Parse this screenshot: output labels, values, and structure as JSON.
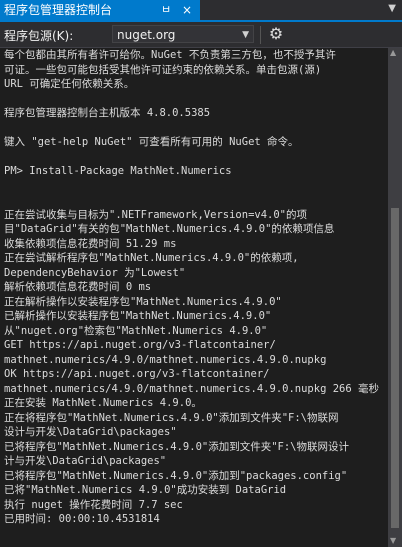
{
  "tab": {
    "title": "程序包管理器控制台",
    "pin": "ㅂ",
    "close": "×"
  },
  "toolbar": {
    "source_label": "程序包源(K):",
    "source_value": "nuget.org",
    "dropdown_arrow": "▼",
    "settings_icon": "⚙"
  },
  "window": {
    "dropdown_arrow": "▼"
  },
  "console": {
    "lines": [
      "每个包都由其所有者许可给你。NuGet 不负责第三方包，也不授予其许",
      "可证。一些包可能包括受其他许可证约束的依赖关系。单击包源(源)",
      "URL 可确定任何依赖关系。",
      "",
      "程序包管理器控制台主机版本 4.8.0.5385",
      "",
      "键入 \"get-help NuGet\" 可查看所有可用的 NuGet 命令。",
      "",
      "PM> Install-Package MathNet.Numerics",
      "",
      "",
      "正在尝试收集与目标为\".NETFramework,Version=v4.0\"的项",
      "目\"DataGrid\"有关的包\"MathNet.Numerics.4.9.0\"的依赖项信息",
      "收集依赖项信息花费时间 51.29 ms",
      "正在尝试解析程序包\"MathNet.Numerics.4.9.0\"的依赖项,",
      "DependencyBehavior 为\"Lowest\"",
      "解析依赖项信息花费时间 0 ms",
      "正在解析操作以安装程序包\"MathNet.Numerics.4.9.0\"",
      "已解析操作以安装程序包\"MathNet.Numerics.4.9.0\"",
      "从\"nuget.org\"检索包\"MathNet.Numerics 4.9.0\"",
      "  GET https://api.nuget.org/v3-flatcontainer/",
      "mathnet.numerics/4.9.0/mathnet.numerics.4.9.0.nupkg",
      "  OK https://api.nuget.org/v3-flatcontainer/",
      "mathnet.numerics/4.9.0/mathnet.numerics.4.9.0.nupkg 266 毫秒",
      "正在安装 MathNet.Numerics 4.9.0。",
      "正在将程序包\"MathNet.Numerics.4.9.0\"添加到文件夹\"F:\\物联网",
      "设计与开发\\DataGrid\\packages\"",
      "已将程序包\"MathNet.Numerics.4.9.0\"添加到文件夹\"F:\\物联网设计",
      "计与开发\\DataGrid\\packages\"",
      "已将程序包\"MathNet.Numerics.4.9.0\"添加到\"packages.config\"",
      "已将\"MathNet.Numerics 4.9.0\"成功安装到 DataGrid",
      "执行 nuget 操作花费时间 7.7 sec",
      "已用时间: 00:00:10.4531814"
    ]
  },
  "scrollbar": {
    "up": "▲",
    "down": "▼"
  }
}
